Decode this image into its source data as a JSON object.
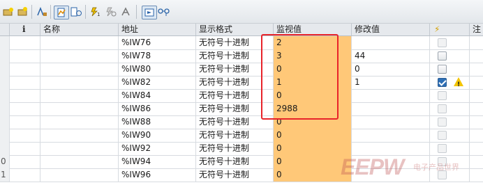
{
  "toolbar": {
    "icons": [
      "insert-row-icon",
      "add-row-icon",
      "sort-icon",
      "monitor-icon",
      "monitor-all-icon",
      "modify-value-icon",
      "modify-all-icon",
      "force-icon",
      "view-toggle-icon",
      "glasses-icon"
    ]
  },
  "table": {
    "headers": {
      "info": "i",
      "name": "名称",
      "address": "地址",
      "display_format": "显示格式",
      "monitor_value": "监视值",
      "modify_value": "修改值",
      "modify_flag": "⚡",
      "comment": "注"
    },
    "rows": [
      {
        "rownum": "",
        "name": "",
        "address": "%IW76",
        "format": "无符号十进制",
        "monitor": "2",
        "modify": "",
        "check": "disabled"
      },
      {
        "rownum": "",
        "name": "",
        "address": "%IW78",
        "format": "无符号十进制",
        "monitor": "3",
        "modify": "44",
        "check": "unchecked"
      },
      {
        "rownum": "",
        "name": "",
        "address": "%IW80",
        "format": "无符号十进制",
        "monitor": "0",
        "modify": "0",
        "check": "unchecked"
      },
      {
        "rownum": "",
        "name": "",
        "address": "%IW82",
        "format": "无符号十进制",
        "monitor": "1",
        "modify": "1",
        "check": "checked",
        "warning": true
      },
      {
        "rownum": "",
        "name": "",
        "address": "%IW84",
        "format": "无符号十进制",
        "monitor": "0",
        "modify": "",
        "check": "disabled"
      },
      {
        "rownum": "",
        "name": "",
        "address": "%IW86",
        "format": "无符号十进制",
        "monitor": "2988",
        "modify": "",
        "check": "disabled"
      },
      {
        "rownum": "",
        "name": "",
        "address": "%IW88",
        "format": "无符号十进制",
        "monitor": "0",
        "modify": "",
        "check": "disabled"
      },
      {
        "rownum": "",
        "name": "",
        "address": "%IW90",
        "format": "无符号十进制",
        "monitor": "0",
        "modify": "",
        "check": "disabled"
      },
      {
        "rownum": "",
        "name": "",
        "address": "%IW92",
        "format": "无符号十进制",
        "monitor": "0",
        "modify": "",
        "check": "disabled"
      },
      {
        "rownum": "0",
        "name": "",
        "address": "%IW94",
        "format": "无符号十进制",
        "monitor": "0",
        "modify": "",
        "check": "disabled"
      },
      {
        "rownum": "1",
        "name": "",
        "address": "%IW96",
        "format": "无符号十进制",
        "monitor": "0",
        "modify": "",
        "check": "disabled"
      }
    ]
  },
  "highlight_color": "#ffc878",
  "annotation_color": "#e8232a",
  "watermark": {
    "brand": "EEPW",
    "sub": "电子产品世界"
  }
}
